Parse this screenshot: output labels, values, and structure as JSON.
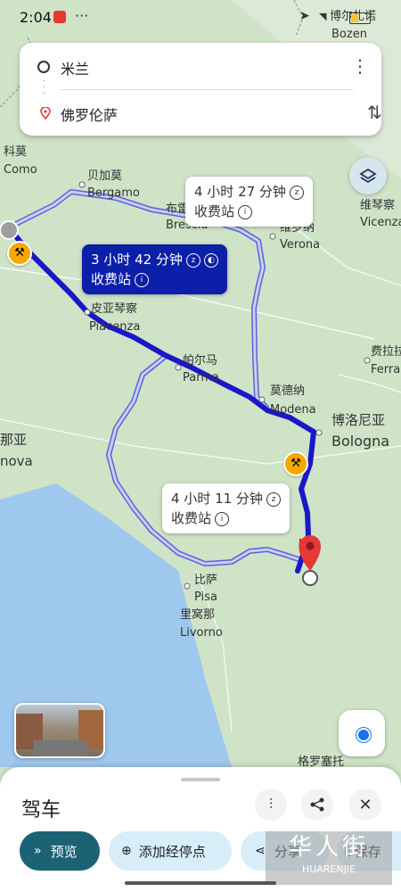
{
  "status_bar": {
    "time": "2:04",
    "dots": "···"
  },
  "directions": {
    "origin": "米兰",
    "destination": "佛罗伦萨",
    "more_icon": "more-vert-icon",
    "swap_icon": "swap-icon"
  },
  "layers_icon": "layers-icon",
  "routes": [
    {
      "duration": "3 小时 42 分钟",
      "toll": "收费站",
      "selected": true
    },
    {
      "duration": "4 小时 27 分钟",
      "toll": "收费站",
      "selected": false
    },
    {
      "duration": "4 小时 11 分钟",
      "toll": "收费站",
      "selected": false
    }
  ],
  "places": {
    "bolzano_cn": "博尔扎诺",
    "bolzano": "Bozen",
    "como_cn": "科莫",
    "como": "Como",
    "bergamo_cn": "贝加莫",
    "bergamo": "Bergamo",
    "brescia_cn": "布雷",
    "brescia": "Brescia",
    "verona_cn": "维罗纳",
    "verona": "Verona",
    "vicenza_cn": "维琴察",
    "vicenza": "Vicenza",
    "piacenza_cn": "皮亚琴察",
    "piacenza": "Piacenza",
    "ferrara_cn": "费拉拉",
    "ferrara": "Ferra",
    "parma_cn": "帕尔马",
    "parma": "Parma",
    "modena_cn": "莫德纳",
    "modena": "Modena",
    "bologna_cn": "博洛尼亚",
    "bologna": "Bologna",
    "genova_cn": "那亚",
    "genova": "nova",
    "pisa_cn": "比萨",
    "pisa": "Pisa",
    "livorno_cn": "里窝那",
    "livorno": "Livorno",
    "grosseto_cn": "格罗塞托"
  },
  "colors": {
    "selected_route": "#1a17c9",
    "alt_route": "#a9b2f0",
    "water": "#9fc8ee",
    "land": "#cfe3c7",
    "pin": "#e53935"
  },
  "bottom_sheet": {
    "title": "驾车",
    "preview": "预览",
    "add_stop": "添加经停点",
    "share": "分享",
    "save": "保存"
  },
  "watermark": {
    "cn": "华人街",
    "en": "HUARENJIE"
  }
}
